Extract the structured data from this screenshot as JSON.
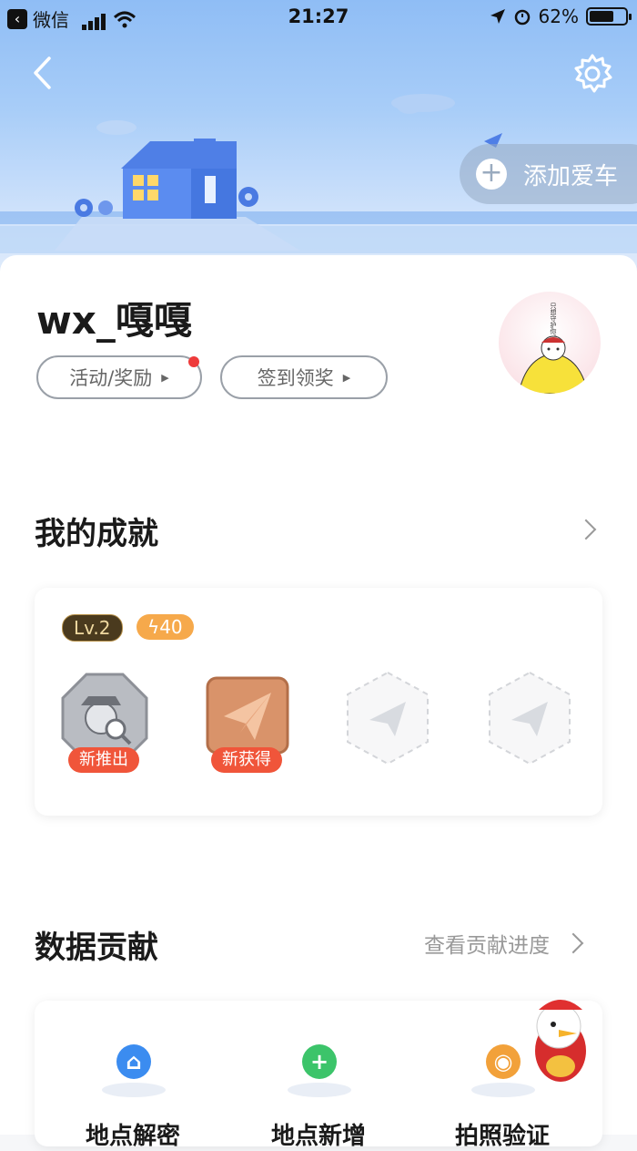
{
  "status_bar": {
    "back_app": "微信",
    "time": "21:27",
    "battery": "62%"
  },
  "header": {
    "add_car_label": "添加爱车"
  },
  "profile": {
    "username": "wx_嘎嘎",
    "activities_label": "活动/奖励",
    "checkin_label": "签到领奖",
    "avatar_text": "只想守护你。"
  },
  "achievements": {
    "title": "我的成就",
    "level": "Lv.2",
    "energy": "40",
    "badges": [
      {
        "tag": "新推出",
        "style": "silver-detective"
      },
      {
        "tag": "新获得",
        "style": "bronze-plane"
      },
      {
        "tag": "",
        "style": "locked-plane"
      },
      {
        "tag": "",
        "style": "locked-plane"
      }
    ]
  },
  "contribution": {
    "title": "数据贡献",
    "view_progress": "查看贡献进度",
    "items": [
      {
        "label": "地点解密",
        "color": "#3b8cf0",
        "icon": "unlock-icon"
      },
      {
        "label": "地点新增",
        "color": "#3cc46a",
        "icon": "plus-icon"
      },
      {
        "label": "拍照验证",
        "color": "#f2a13a",
        "icon": "camera-icon"
      }
    ]
  }
}
